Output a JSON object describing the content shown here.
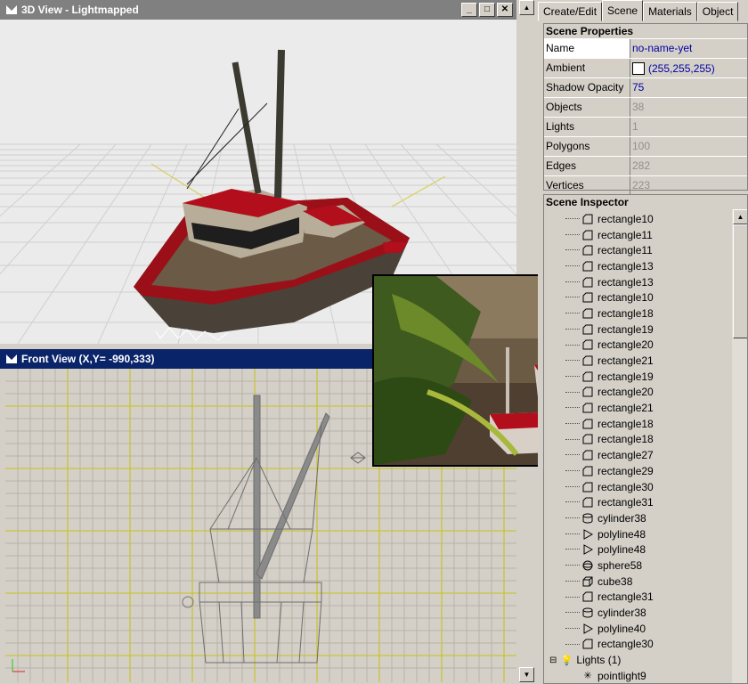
{
  "view3d": {
    "title": "3D View - Lightmapped"
  },
  "front_view": {
    "title": "Front View (X,Y= -990,333)"
  },
  "window_buttons": {
    "minimize": "_",
    "maximize": "□",
    "close": "✕"
  },
  "tabs": [
    {
      "label": "Create/Edit",
      "active": false
    },
    {
      "label": "Scene",
      "active": true
    },
    {
      "label": "Materials",
      "active": false
    },
    {
      "label": "Object",
      "active": false
    }
  ],
  "scene_properties": {
    "title": "Scene Properties",
    "rows": [
      {
        "name": "Name",
        "value": "no-name-yet"
      },
      {
        "name": "Ambient",
        "value": "(255,255,255)"
      },
      {
        "name": "Shadow Opacity",
        "value": "75"
      },
      {
        "name": "Objects",
        "value": "38"
      },
      {
        "name": "Lights",
        "value": "1"
      },
      {
        "name": "Polygons",
        "value": "100"
      },
      {
        "name": "Edges",
        "value": "282"
      },
      {
        "name": "Vertices",
        "value": "223"
      }
    ]
  },
  "inspector": {
    "title": "Scene Inspector",
    "items": [
      {
        "icon": "rectangle-icon",
        "label": "rectangle10"
      },
      {
        "icon": "rectangle-icon",
        "label": "rectangle11"
      },
      {
        "icon": "rectangle-icon",
        "label": "rectangle11"
      },
      {
        "icon": "rectangle-icon",
        "label": "rectangle13"
      },
      {
        "icon": "rectangle-icon",
        "label": "rectangle13"
      },
      {
        "icon": "rectangle-icon",
        "label": "rectangle10"
      },
      {
        "icon": "rectangle-icon",
        "label": "rectangle18"
      },
      {
        "icon": "rectangle-icon",
        "label": "rectangle19"
      },
      {
        "icon": "rectangle-icon",
        "label": "rectangle20"
      },
      {
        "icon": "rectangle-icon",
        "label": "rectangle21"
      },
      {
        "icon": "rectangle-icon",
        "label": "rectangle19"
      },
      {
        "icon": "rectangle-icon",
        "label": "rectangle20"
      },
      {
        "icon": "rectangle-icon",
        "label": "rectangle21"
      },
      {
        "icon": "rectangle-icon",
        "label": "rectangle18"
      },
      {
        "icon": "rectangle-icon",
        "label": "rectangle18"
      },
      {
        "icon": "rectangle-icon",
        "label": "rectangle27"
      },
      {
        "icon": "rectangle-icon",
        "label": "rectangle29"
      },
      {
        "icon": "rectangle-icon",
        "label": "rectangle30"
      },
      {
        "icon": "rectangle-icon",
        "label": "rectangle31"
      },
      {
        "icon": "cylinder-icon",
        "label": "cylinder38"
      },
      {
        "icon": "polyline-icon",
        "label": "polyline48"
      },
      {
        "icon": "polyline-icon",
        "label": "polyline48"
      },
      {
        "icon": "sphere-icon",
        "label": "sphere58"
      },
      {
        "icon": "cube-icon",
        "label": "cube38"
      },
      {
        "icon": "rectangle-icon",
        "label": "rectangle31"
      },
      {
        "icon": "cylinder-icon",
        "label": "cylinder38"
      },
      {
        "icon": "polyline-icon",
        "label": "polyline40"
      },
      {
        "icon": "rectangle-icon",
        "label": "rectangle30"
      }
    ],
    "lights_group": "Lights (1)",
    "light_item": "pointlight9"
  },
  "colors": {
    "active_title": "#0a246a",
    "inactive_title": "#808080",
    "hull_red": "#b0101c",
    "value_blue": "#0000a0"
  }
}
